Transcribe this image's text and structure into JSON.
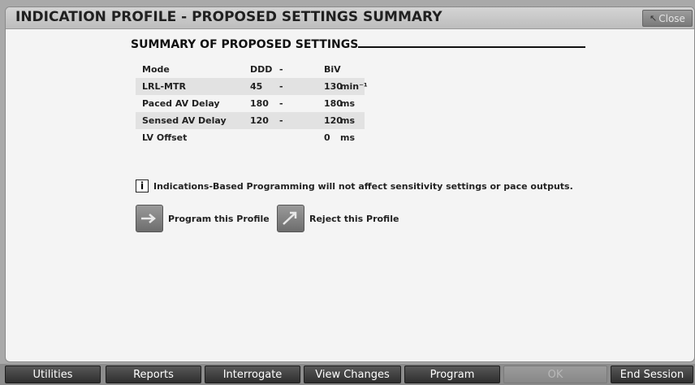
{
  "window": {
    "title": "INDICATION PROFILE - PROPOSED SETTINGS SUMMARY",
    "close_label": "Close"
  },
  "summary": {
    "heading": "SUMMARY OF PROPOSED SETTINGS",
    "header": {
      "label": "Mode",
      "current": "DDD",
      "separator": "-",
      "proposed": "BiV",
      "unit": ""
    },
    "rows": [
      {
        "label": "LRL-MTR",
        "current": "45",
        "separator": "-",
        "proposed": "130",
        "unit": "min⁻¹"
      },
      {
        "label": "Paced AV Delay",
        "current": "180",
        "separator": "-",
        "proposed": "180",
        "unit": "ms"
      },
      {
        "label": "Sensed AV Delay",
        "current": "120",
        "separator": "-",
        "proposed": "120",
        "unit": "ms"
      },
      {
        "label": "LV Offset",
        "current": "",
        "separator": "",
        "proposed": "0",
        "unit": "ms"
      }
    ]
  },
  "info": {
    "icon_text": "i",
    "message": "Indications-Based Programming will not affect sensitivity settings or pace outputs."
  },
  "actions": {
    "program_label": "Program this Profile",
    "reject_label": "Reject this Profile"
  },
  "taskbar": {
    "utilities": "Utilities",
    "reports": "Reports",
    "interrogate": "Interrogate",
    "view_changes": "View Changes",
    "program": "Program",
    "ok": "OK",
    "end_session": "End Session"
  }
}
